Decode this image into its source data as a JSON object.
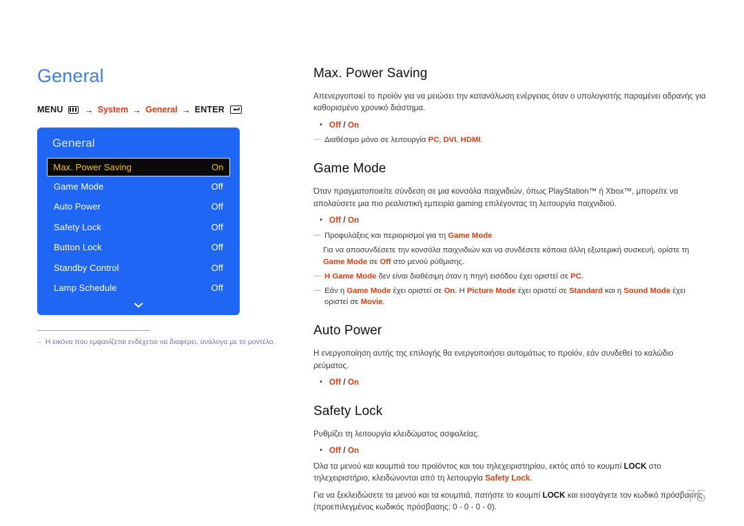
{
  "page": {
    "title": "General",
    "number": "75",
    "background": "#ffffff",
    "title_color": "#3b7df0",
    "accent_color": "#e03a10",
    "osd_blue": "#1f66f5",
    "osd_highlight_text": "#f5c012"
  },
  "breadcrumb": {
    "menu_label": "MENU",
    "menu_icon": "menu-bars-icon",
    "arrow": "→",
    "item1": "System",
    "item2": "General",
    "enter_label": "ENTER",
    "enter_icon": "enter-return-icon"
  },
  "osd": {
    "title": "General",
    "chevron_icon": "chevron-down-icon",
    "rows": [
      {
        "label": "Max. Power Saving",
        "value": "On",
        "selected": true
      },
      {
        "label": "Game Mode",
        "value": "Off",
        "selected": false
      },
      {
        "label": "Auto Power",
        "value": "Off",
        "selected": false
      },
      {
        "label": "Safety Lock",
        "value": "Off",
        "selected": false
      },
      {
        "label": "Button Lock",
        "value": "Off",
        "selected": false
      },
      {
        "label": "Standby Control",
        "value": "Off",
        "selected": false
      },
      {
        "label": "Lamp Schedule",
        "value": "Off",
        "selected": false
      }
    ]
  },
  "left_note": {
    "dash": "–",
    "text": "Η εικόνα που εμφανίζεται ενδέχεται να διαφέρει, ανάλογα με το μοντέλο."
  },
  "sections": {
    "max_power_saving": {
      "title": "Max. Power Saving",
      "body": "Απενεργοποιεί το προϊόν για να μειώσει την κατανάλωση ενέργειας όταν ο υπολογιστής παραμένει αδρανής για καθορισμένο χρονικό διάστημα.",
      "bullet_off": "Off",
      "bullet_sep": " / ",
      "bullet_on": "On",
      "note1_pre": "Διαθέσιμο μόνο σε λειτουργία ",
      "note1_pc": "PC",
      "note1_c1": ", ",
      "note1_dvi": "DVI",
      "note1_c2": ", ",
      "note1_hdmi": "HDMI",
      "note1_end": "."
    },
    "game_mode": {
      "title": "Game Mode",
      "body": "Όταν πραγματοποιείτε σύνδεση σε μια κονσόλα παιχνιδιών, όπως PlayStation™ ή Xbox™, μπορείτε να απολαύσετε μια πιο ρεαλιστική εμπειρία gaming επιλέγοντας τη λειτουργία παιχνιδιού.",
      "bullet_off": "Off",
      "bullet_sep": " / ",
      "bullet_on": "On",
      "note1_pre": "Προφυλάξεις και περιορισμοί για τη ",
      "note1_hl": "Game Mode",
      "note1_sub_pre": "Για να αποσυνδέσετε την κονσόλα παιχνιδιών και να συνδέσετε κάποια άλλη εξωτερική συσκευή, ορίστε τη ",
      "note1_sub_hl1": "Game Mode",
      "note1_sub_mid": " σε ",
      "note1_sub_hl2": "Off",
      "note1_sub_end": " στο μενού ρύθμισης.",
      "note2_h": "Η ",
      "note2_hl1": "Game Mode",
      "note2_mid": " δεν είναι διαθέσιμη όταν η πηγή εισόδου έχει οριστεί σε ",
      "note2_hl2": "PC",
      "note2_end": ".",
      "note3_pre": "Εάν η ",
      "note3_hl1": "Game Mode",
      "note3_m1": " έχει οριστεί σε ",
      "note3_hl2": "On",
      "note3_m2": ". Η ",
      "note3_hl3": "Picture Mode",
      "note3_m3": " έχει οριστεί σε ",
      "note3_hl4": "Standard",
      "note3_m4": " και η ",
      "note3_hl5": "Sound Mode",
      "note3_m5": " έχει οριστεί σε ",
      "note3_hl6": "Movie",
      "note3_end": "."
    },
    "auto_power": {
      "title": "Auto Power",
      "body": "Η ενεργοποίηση αυτής της επιλογής θα ενεργοποιήσει αυτομάτως το προϊόν, εάν συνδεθεί το καλώδιο ρεύματος.",
      "bullet_off": "Off",
      "bullet_sep": " / ",
      "bullet_on": "On"
    },
    "safety_lock": {
      "title": "Safety Lock",
      "body": "Ρυθμίζει τη λειτουργία κλειδώματος ασφαλείας.",
      "bullet_off": "Off",
      "bullet_sep": " / ",
      "bullet_on": "On",
      "p2_pre": "Όλα τα μενού και κουμπιά του προϊόντος και του τηλεχειριστηρίου, εκτός από το κουμπί ",
      "p2_lock": "LOCK",
      "p2_mid": " στο τηλεχειριστήριο, κλειδώνονται από τη λειτουργία ",
      "p2_hl": "Safety Lock",
      "p2_end": ".",
      "p3_pre": "Για να ξεκλειδώσετε τα μενού και τα κουμπιά, πατήστε το κουμπί ",
      "p3_lock": "LOCK",
      "p3_end": " και εισαγάγετε τον κωδικό πρόσβασης (προεπιλεγμένος κωδικός πρόσβασης: 0 - 0 - 0 - 0)."
    }
  }
}
